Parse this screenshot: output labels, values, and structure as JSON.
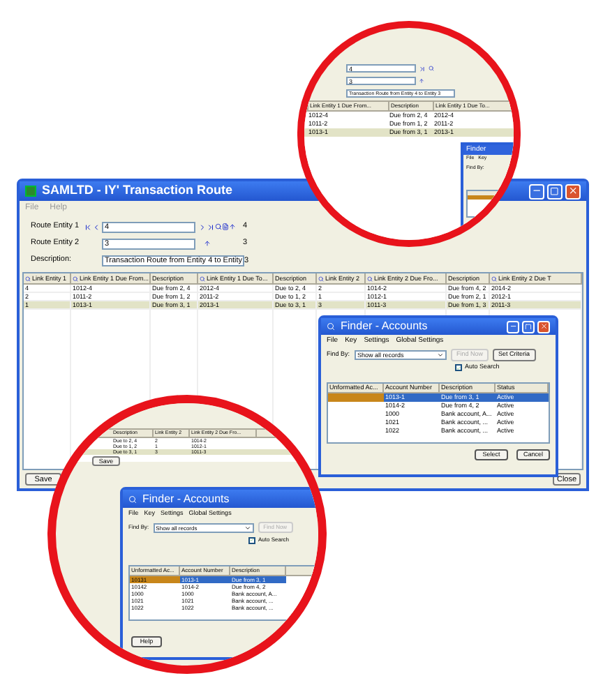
{
  "main_window": {
    "title": "SAMLTD - IY' Transaction Route",
    "menu": [
      "File",
      "Help"
    ],
    "route_entities": [
      {
        "label": "Route Entity 1",
        "value": "4",
        "count": "4"
      },
      {
        "label": "Route Entity 2",
        "value": "3",
        "count": "3"
      }
    ],
    "description": {
      "label": "Description:",
      "value": "Transaction Route from Entity 4 to Entity 3"
    },
    "table": {
      "columns": [
        "Link Entity 1",
        "Link Entity 1 Due From...",
        "Description",
        "Link Entity 1 Due To...",
        "Description",
        "Link Entity 2",
        "Link Entity 2 Due Fro...",
        "Description",
        "Link Entity 2 Due T"
      ],
      "rows": [
        {
          "cells": [
            "4",
            "1012-4",
            "Due from 2, 4",
            "2012-4",
            "Due to 2, 4",
            "2",
            "1014-2",
            "Due from 4, 2",
            "2014-2"
          ],
          "selected": false
        },
        {
          "cells": [
            "2",
            "1011-2",
            "Due from 1, 2",
            "2011-2",
            "Due to 1, 2",
            "1",
            "1012-1",
            "Due from 2, 1",
            "2012-1"
          ],
          "selected": false
        },
        {
          "cells": [
            "1",
            "1013-1",
            "Due from 3, 1",
            "2013-1",
            "Due to 3, 1",
            "3",
            "1011-3",
            "Due from 1, 3",
            "2011-3"
          ],
          "selected": true
        }
      ]
    },
    "buttons": [
      "Save",
      "Close"
    ]
  },
  "finder": {
    "title": "Finder - Accounts",
    "menu": [
      "File",
      "Key",
      "Settings",
      "Global Settings"
    ],
    "find_by": {
      "label": "Find By:",
      "value": "Show all records"
    },
    "buttons": [
      {
        "label": "Find Now",
        "disabled": true
      },
      {
        "label": "Set Criteria",
        "disabled": false
      }
    ],
    "auto_search": {
      "label": "Auto Search",
      "checked": true
    },
    "table": {
      "columns": [
        "Unformatted Ac...",
        "Account Number",
        "Description",
        "Status"
      ],
      "rows": [
        {
          "cells": [
            "",
            "1013-1",
            "Due from 3, 1",
            "Active"
          ],
          "selected": true
        },
        {
          "cells": [
            "",
            "1014-2",
            "Due from 4, 2",
            "Active"
          ],
          "selected": false
        },
        {
          "cells": [
            "",
            "1000",
            "Bank account, A...",
            "Active"
          ],
          "selected": false
        },
        {
          "cells": [
            "",
            "1021",
            "Bank account, ...",
            "Active"
          ],
          "selected": false
        },
        {
          "cells": [
            "",
            "1022",
            "Bank account, ...",
            "Active"
          ],
          "selected": false
        }
      ]
    },
    "actions": [
      "Select",
      "Cancel"
    ]
  },
  "top_magnifier": {
    "entity_1": "4",
    "entity_2": "3",
    "description": "Transaction Route from Entity 4 to Entity 3",
    "columns": [
      "Link Entity 1 Due From...",
      "Description",
      "Link Entity 1 Due To..."
    ],
    "rows": [
      {
        "cells": [
          "1012-4",
          "Due from 2, 4",
          "2012-4"
        ],
        "selected": false
      },
      {
        "cells": [
          "1011-2",
          "Due from 1, 2",
          "2011-2"
        ],
        "selected": false
      },
      {
        "cells": [
          "1013-1",
          "Due from 3, 1",
          "2013-1"
        ],
        "selected": true
      }
    ],
    "finder_title": "Finder",
    "finder_menu": [
      "File",
      "Key"
    ],
    "finder_find_by": "Find By:"
  },
  "bottom_magnifier": {
    "columns": [
      "Description",
      "Link Entity 2",
      "Link Entity 2 Due Fro..."
    ],
    "rows": [
      {
        "cells": [
          "Due to 2, 4",
          "2",
          "1014-2"
        ],
        "selected": false
      },
      {
        "cells": [
          "Due to 1, 2",
          "1",
          "1012-1"
        ],
        "selected": false
      },
      {
        "cells": [
          "Due to 3, 1",
          "3",
          "1011-3"
        ],
        "selected": true
      }
    ],
    "save": "Save",
    "finder": {
      "title": "Finder - Accounts",
      "menu": [
        "File",
        "Key",
        "Settings",
        "Global Settings"
      ],
      "find_by": "Find By:",
      "select": "Show all records",
      "find_now": "Find Now",
      "auto_search": "Auto Search",
      "auto_search_checked": true,
      "columns": [
        "Unformatted Ac...",
        "Account Number",
        "Description"
      ],
      "rows": [
        {
          "cells": [
            "10131",
            "1013-1",
            "Due from 3, 1"
          ],
          "selected": true
        },
        {
          "cells": [
            "10142",
            "1014-2",
            "Due from 4, 2"
          ],
          "selected": false
        },
        {
          "cells": [
            "1000",
            "1000",
            "Bank account, A..."
          ],
          "selected": false
        },
        {
          "cells": [
            "1021",
            "1021",
            "Bank account, ..."
          ],
          "selected": false
        },
        {
          "cells": [
            "1022",
            "1022",
            "Bank account, ..."
          ],
          "selected": false
        }
      ],
      "help": "Help"
    }
  }
}
